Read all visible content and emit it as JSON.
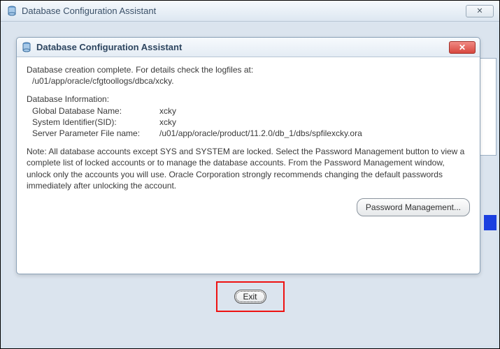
{
  "outer": {
    "title": "Database Configuration Assistant",
    "close_glyph": "✕"
  },
  "inner": {
    "title": "Database Configuration Assistant",
    "close_glyph": "✕"
  },
  "content": {
    "creation_line1": "Database creation complete. For details check the logfiles at:",
    "creation_line2": "/u01/app/oracle/cfgtoollogs/dbca/xcky.",
    "info_heading": "Database Information:",
    "rows": {
      "gdn_label": "Global Database Name:",
      "gdn_value": "xcky",
      "sid_label": "System Identifier(SID):",
      "sid_value": "xcky",
      "spf_label": "Server Parameter File name:",
      "spf_value": "/u01/app/oracle/product/11.2.0/db_1/dbs/spfilexcky.ora"
    },
    "note": "Note: All database accounts except SYS and SYSTEM are locked. Select the Password Management button to view a complete list of locked accounts or to manage the database accounts. From the Password Management window, unlock only the accounts you will use. Oracle Corporation strongly recommends changing the default passwords immediately after unlocking the account."
  },
  "buttons": {
    "password_mgmt": "Password Management...",
    "exit": "Exit"
  }
}
